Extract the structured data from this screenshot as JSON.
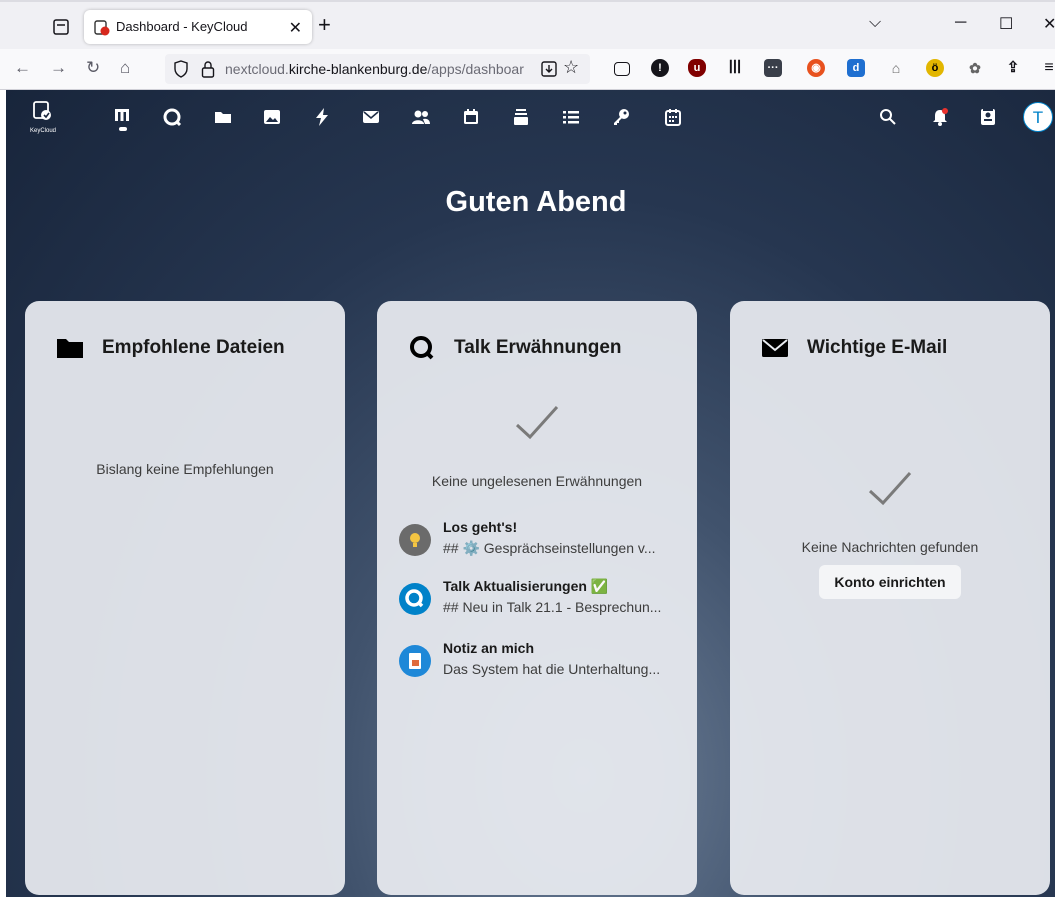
{
  "browser": {
    "tab_title": "Dashboard - KeyCloud",
    "url_domain_pre": "nextcloud.",
    "url_domain_main": "kirche-blankenburg.de",
    "url_path": "/apps/dashboar"
  },
  "header": {
    "logo_text": "KeyCloud",
    "avatar_initial": "T",
    "apps": [
      "dashboard-icon",
      "talk-icon",
      "files-icon",
      "photos-icon",
      "activity-icon",
      "mail-icon",
      "contacts-icon",
      "calendar-icon",
      "deck-icon",
      "tasks-icon",
      "passwords-icon",
      "calendar-alt-icon"
    ]
  },
  "greeting": "Guten Abend",
  "panels": {
    "files": {
      "title": "Empfohlene Dateien",
      "empty": "Bislang keine Empfehlungen"
    },
    "talk": {
      "title": "Talk Erwähnungen",
      "empty": "Keine ungelesenen Erwähnungen",
      "items": [
        {
          "title": "Los geht's!",
          "subtitle": "## ⚙️  Gesprächseinstellungen v..."
        },
        {
          "title": "Talk Aktualisierungen ✅",
          "subtitle": "## Neu in Talk 21.1 - Besprechun..."
        },
        {
          "title": "Notiz an mich",
          "subtitle": "Das System hat die Unterhaltung..."
        }
      ]
    },
    "mail": {
      "title": "Wichtige E-Mail",
      "empty": "Keine Nachrichten gefunden",
      "button": "Konto einrichten"
    }
  },
  "colors": {
    "accent": "#0082c9",
    "panel_bg": "#e9ecf1",
    "header_bg": "#18253b"
  }
}
